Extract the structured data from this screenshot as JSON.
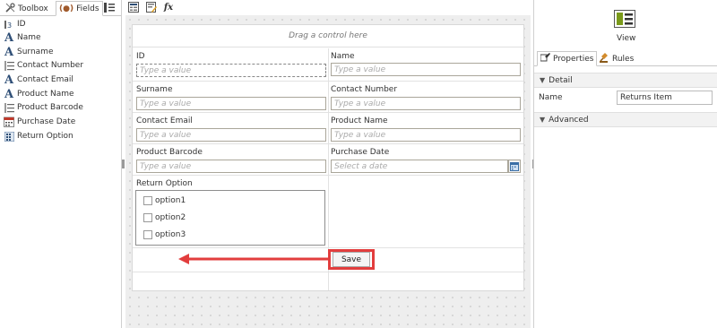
{
  "left_panel": {
    "tabs": [
      {
        "label": "Toolbox",
        "icon": "tools-icon"
      },
      {
        "label": "Fields",
        "icon": "fields-icon"
      }
    ],
    "fields": [
      {
        "label": "ID",
        "icon": "autonumber-icon"
      },
      {
        "label": "Name",
        "icon": "text-icon"
      },
      {
        "label": "Surname",
        "icon": "text-icon"
      },
      {
        "label": "Contact Number",
        "icon": "list-icon"
      },
      {
        "label": "Contact Email",
        "icon": "text-icon"
      },
      {
        "label": "Product Name",
        "icon": "text-icon"
      },
      {
        "label": "Product Barcode",
        "icon": "list-icon"
      },
      {
        "label": "Purchase Date",
        "icon": "calendar-icon"
      },
      {
        "label": "Return Option",
        "icon": "grid-icon"
      }
    ]
  },
  "toolbar": {
    "formula_icon_label": "fx"
  },
  "form": {
    "drag_hint": "Drag a control here",
    "fields": {
      "id": {
        "label": "ID",
        "placeholder": "Type a value"
      },
      "name": {
        "label": "Name",
        "placeholder": "Type a value"
      },
      "surname": {
        "label": "Surname",
        "placeholder": "Type a value"
      },
      "contact_number": {
        "label": "Contact Number",
        "placeholder": "Type a value"
      },
      "contact_email": {
        "label": "Contact Email",
        "placeholder": "Type a value"
      },
      "product_name": {
        "label": "Product Name",
        "placeholder": "Type a value"
      },
      "product_barcode": {
        "label": "Product Barcode",
        "placeholder": "Type a value"
      },
      "purchase_date": {
        "label": "Purchase Date",
        "placeholder": "Select a date"
      }
    },
    "return_option": {
      "label": "Return Option",
      "options": [
        "option1",
        "option2",
        "option3"
      ]
    },
    "save_label": "Save"
  },
  "right_panel": {
    "view_label": "View",
    "tabs": [
      {
        "label": "Properties",
        "icon": "properties-icon"
      },
      {
        "label": "Rules",
        "icon": "rules-icon"
      }
    ],
    "detail": {
      "header": "Detail",
      "name_label": "Name",
      "name_value": "Returns Item"
    },
    "advanced_header": "Advanced"
  },
  "colors": {
    "accent": "#e23d3d",
    "icon_blue": "#2e4e76",
    "view_green": "#7a9a1a"
  }
}
